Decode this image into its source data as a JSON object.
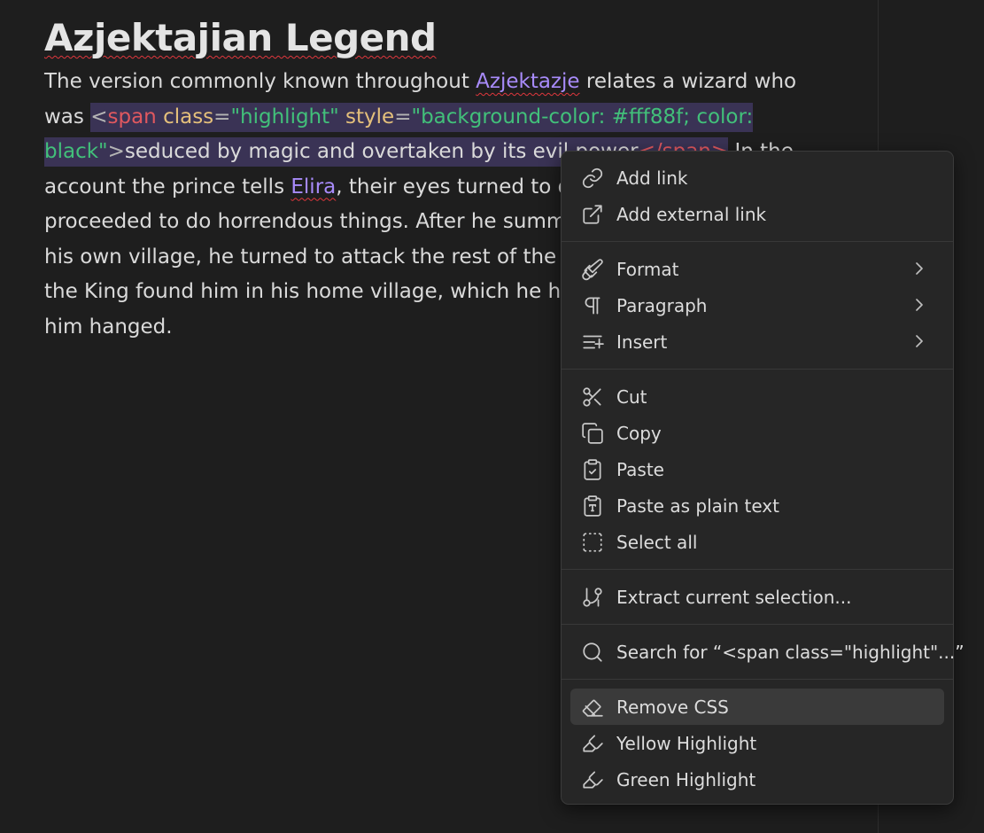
{
  "note": {
    "title": "Azjektajian Legend",
    "lines": {
      "l1": {
        "a": "The version commonly known throughout ",
        "link": "Azjektazje",
        "b": " relates a wizard who"
      },
      "l2": {
        "a": "was ",
        "lt": "<",
        "tag1": "span",
        "attr1": "class",
        "eq1": "=",
        "val1": "\"highlight\"",
        "attr2": "style",
        "eq2": "=",
        "val2a": "\"background-color: #fff88f; color:"
      },
      "l3": {
        "val2b": "black\"",
        "gt": ">",
        "seltext": "seduced by magic and overtaken by its evil power",
        "close": "</span>",
        "b": " In the"
      },
      "l4": {
        "a": "account the prince tells ",
        "link": "Elira",
        "b": ", their eyes turned to d"
      },
      "l5": {
        "a": "proceeded to do horrendous things. After he summ"
      },
      "l6": {
        "a": "his own village, he turned to attack the rest of the"
      },
      "l7": {
        "a": "the King found him in his home village, which he h"
      },
      "l8": {
        "a": "him hanged."
      }
    }
  },
  "menu": {
    "add_link": "Add link",
    "add_external_link": "Add external link",
    "format": "Format",
    "paragraph": "Paragraph",
    "insert": "Insert",
    "cut": "Cut",
    "copy": "Copy",
    "paste": "Paste",
    "paste_plain": "Paste as plain text",
    "select_all": "Select all",
    "extract": "Extract current selection...",
    "search": "Search for “<span class=\"highlight\"...”",
    "remove_css": "Remove CSS",
    "yellow_highlight": "Yellow Highlight",
    "green_highlight": "Green Highlight"
  },
  "icons": {
    "add_link": "link-icon",
    "add_external_link": "external-link-icon",
    "format": "paintbrush-icon",
    "paragraph": "pilcrow-icon",
    "insert": "list-plus-icon",
    "cut": "scissors-icon",
    "copy": "copy-icon",
    "paste": "clipboard-check-icon",
    "paste_plain": "clipboard-type-icon",
    "select_all": "dashed-square-icon",
    "extract": "git-branch-plus-icon",
    "search": "search-icon",
    "remove_css": "eraser-icon",
    "highlight": "highlighter-icon",
    "submenu": "chevron-right-icon"
  },
  "colors": {
    "background": "#1e1e1e",
    "text": "#dadada",
    "link": "#a88bfa",
    "selection": "#3a3355",
    "tag": "#e0585f",
    "attribute": "#e5c07b",
    "string": "#42c07a",
    "menu_bg": "#262626",
    "menu_active": "#3a3a3a"
  }
}
